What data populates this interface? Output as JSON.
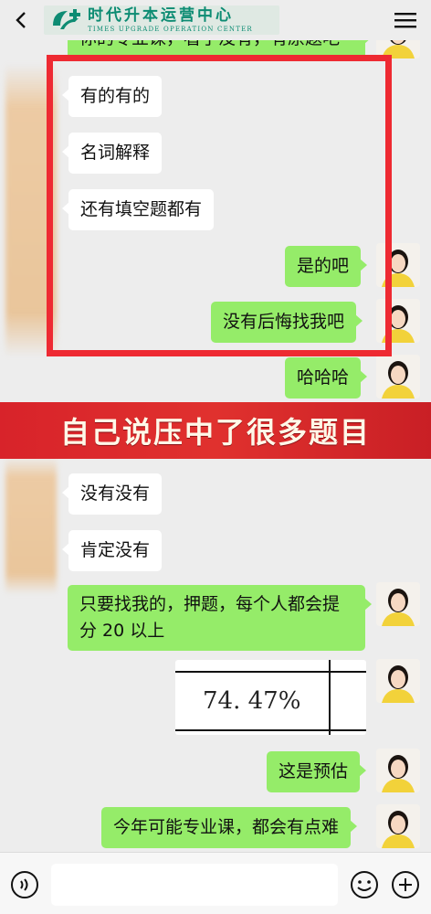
{
  "header": {
    "logo_cn": "时代升本运营中心",
    "logo_en": "TIMES UPGRADE OPERATION CENTER"
  },
  "messages": [
    {
      "side": "right",
      "text": "你的专业课，看了没有，有原题吧"
    },
    {
      "side": "left",
      "text": "有的有的"
    },
    {
      "side": "left",
      "text": "名词解释"
    },
    {
      "side": "left",
      "text": "还有填空题都有"
    },
    {
      "side": "right",
      "text": "是的吧"
    },
    {
      "side": "right",
      "text": "没有后悔找我吧"
    },
    {
      "side": "right",
      "text": "哈哈哈"
    },
    {
      "side": "left",
      "text": "没有没有"
    },
    {
      "side": "left",
      "text": "肯定没有"
    },
    {
      "side": "right",
      "text": "只要找我的，押题，每个人都会提分 20 以上"
    },
    {
      "side": "right",
      "image_value": "74. 47%"
    },
    {
      "side": "right",
      "text": "这是预估"
    },
    {
      "side": "right",
      "text": "今年可能专业课，都会有点难"
    }
  ],
  "banner": {
    "text": "自己说压中了很多题目"
  },
  "input": {
    "placeholder": ""
  },
  "colors": {
    "sent_bubble": "#95ec69",
    "received_bubble": "#ffffff",
    "highlight_box": "#ee2a32",
    "banner_bg": "#d8232a",
    "brand": "#0d8c73"
  },
  "icons": [
    "back-icon",
    "more-icon",
    "voice-icon",
    "emoji-icon",
    "plus-icon"
  ]
}
